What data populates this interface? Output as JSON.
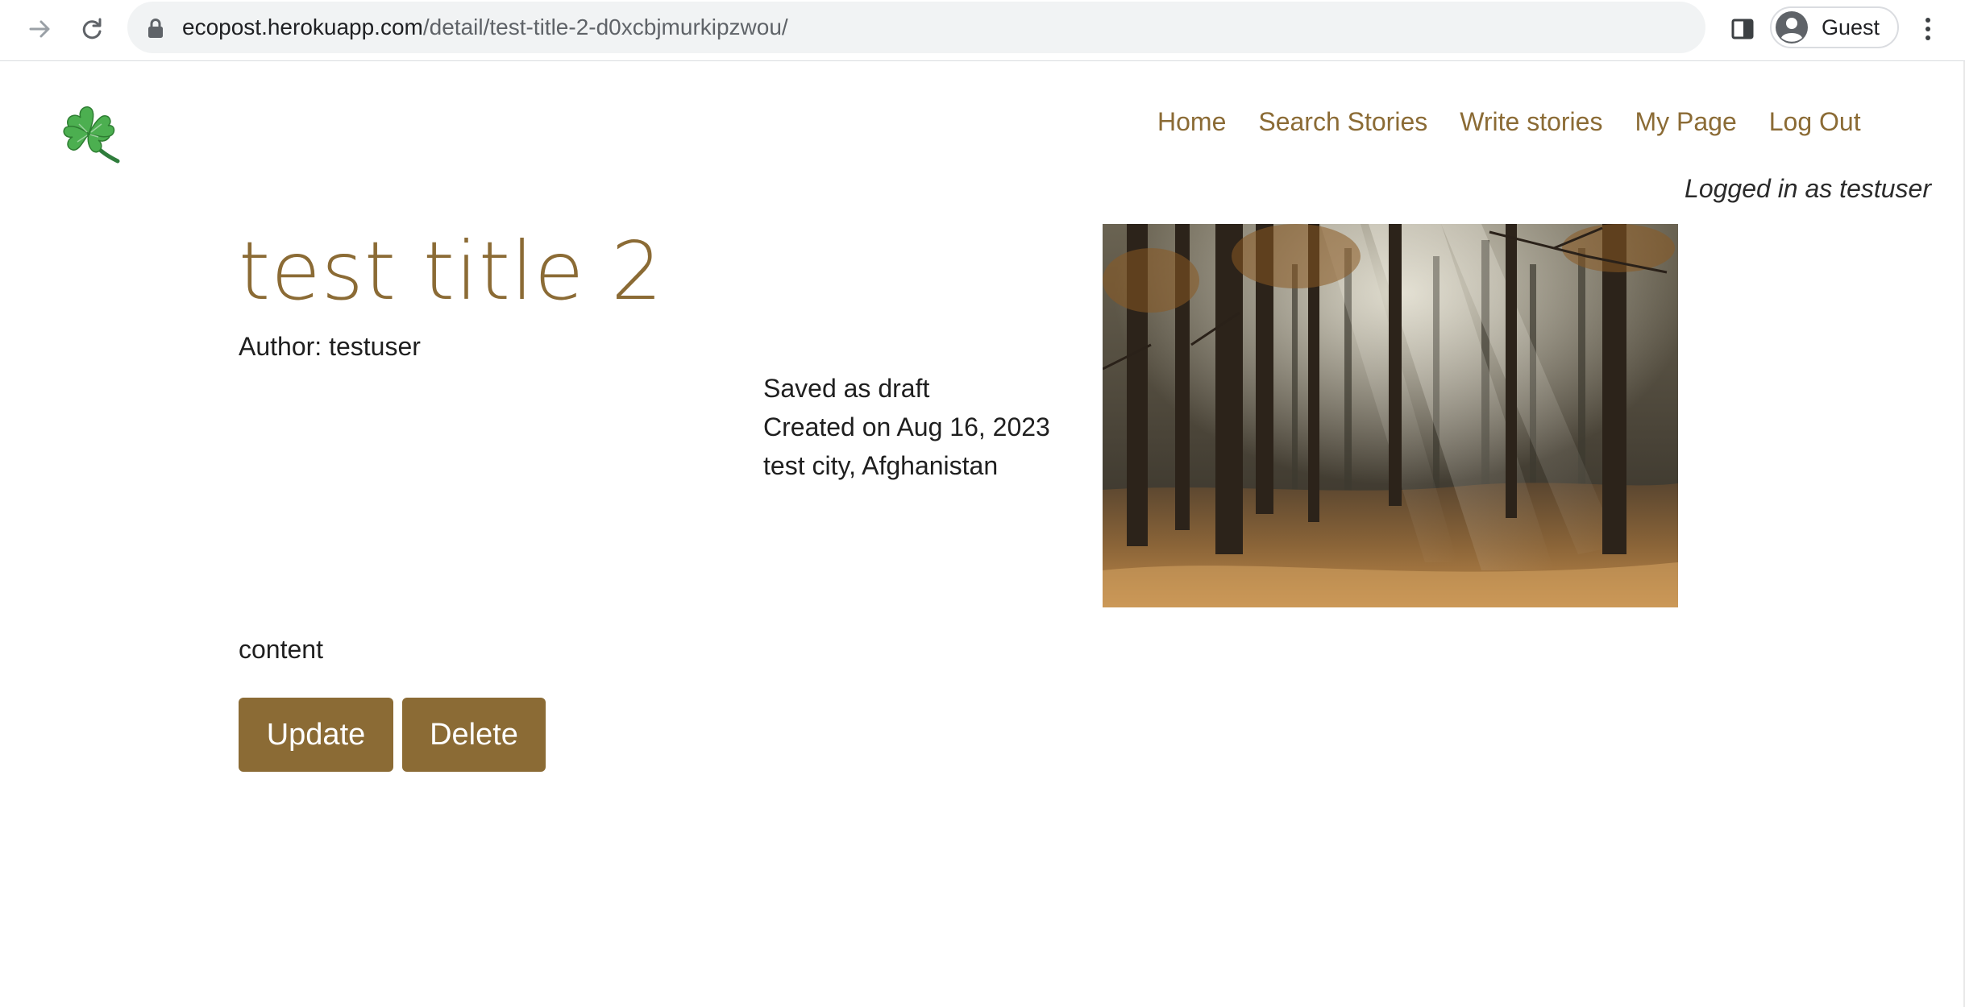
{
  "browser": {
    "url_host": "ecopost.herokuapp.com",
    "url_path": "/detail/test-title-2-d0xcbjmurkipzwou/",
    "profile_label": "Guest",
    "icons": {
      "forward": "arrow-forward-icon",
      "reload": "reload-icon",
      "lock": "lock-icon",
      "side_panel": "side-panel-icon",
      "avatar": "avatar-icon",
      "menu": "kebab-menu-icon"
    }
  },
  "site": {
    "logo": "four-leaf-clover-logo",
    "nav": {
      "home": "Home",
      "search": "Search Stories",
      "write": "Write stories",
      "my_page": "My Page",
      "logout": "Log Out"
    },
    "login_status": "Logged in as testuser",
    "accent_color": "#8b6b35"
  },
  "story": {
    "title": "test title 2",
    "author_line": "Author: testuser",
    "status": "Saved as draft",
    "created": "Created on Aug 16, 2023",
    "location": "test city, Afghanistan",
    "image": "forest-sunbeams-photo",
    "content": "content",
    "update_label": "Update",
    "delete_label": "Delete"
  }
}
